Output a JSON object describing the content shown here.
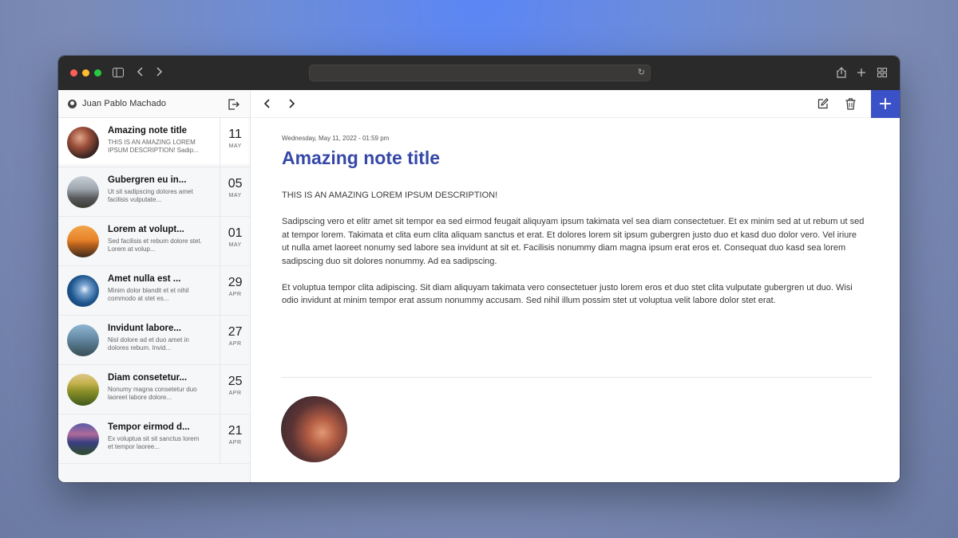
{
  "user": {
    "name": "Juan Pablo Machado"
  },
  "notes": [
    {
      "title": "Amazing note title",
      "desc": "THIS IS AN AMAZING LOREM IPSUM DESCRIPTION! Sadip...",
      "day": "11",
      "month": "MAY"
    },
    {
      "title": "Gubergren eu in...",
      "desc": "Ut sit sadipscing dolores amet facilisis vulputate...",
      "day": "05",
      "month": "MAY"
    },
    {
      "title": "Lorem at volupt...",
      "desc": "Sed facilisis et rebum dolore stet. Lorem at volup...",
      "day": "01",
      "month": "MAY"
    },
    {
      "title": "Amet nulla est ...",
      "desc": "Minim dolor blandit et et nihil commodo at stet es...",
      "day": "29",
      "month": "APR"
    },
    {
      "title": "Invidunt labore...",
      "desc": "Nisl dolore ad et duo amet in dolores rebum. Invid...",
      "day": "27",
      "month": "APR"
    },
    {
      "title": "Diam consetetur...",
      "desc": "Nonumy magna consetetur duo laoreet labore dolore...",
      "day": "25",
      "month": "APR"
    },
    {
      "title": "Tempor eirmod d...",
      "desc": "Ex voluptua sit sit sanctus lorem et tempor laoree...",
      "day": "21",
      "month": "APR"
    }
  ],
  "toolbar": {
    "add_label": "+"
  },
  "note": {
    "meta": "Wednesday, May 11, 2022 - 01:59 pm",
    "title": "Amazing note title",
    "para1": "THIS IS AN AMAZING LOREM IPSUM DESCRIPTION!",
    "para2": "Sadipscing vero et elitr amet sit tempor ea sed eirmod feugait aliquyam ipsum takimata vel sea diam consectetuer. Et ex minim sed at ut rebum ut sed at tempor lorem. Takimata et clita eum clita aliquam sanctus et erat. Et dolores lorem sit ipsum gubergren justo duo et kasd duo dolor vero. Vel iriure ut nulla amet laoreet nonumy sed labore sea invidunt at sit et. Facilisis nonummy diam magna ipsum erat eros et. Consequat duo kasd sea lorem sadipscing duo sit dolores nonummy. Ad ea sadipscing.",
    "para3": "Et voluptua tempor clita adipiscing. Sit diam aliquyam takimata vero consectetuer justo lorem eros et duo stet clita vulputate gubergren ut duo. Wisi odio invidunt at minim tempor erat assum nonummy accusam. Sed nihil illum possim stet ut voluptua velit labore dolor stet erat."
  },
  "colors": {
    "accent": "#3a51c7",
    "title": "#3548a8"
  },
  "icons": [
    "sidebar-toggle-icon",
    "back-icon",
    "forward-icon",
    "reload-icon",
    "share-icon",
    "new-tab-icon",
    "tabs-overview-icon",
    "user-icon",
    "logout-icon",
    "edit-icon",
    "trash-icon",
    "plus-icon"
  ]
}
